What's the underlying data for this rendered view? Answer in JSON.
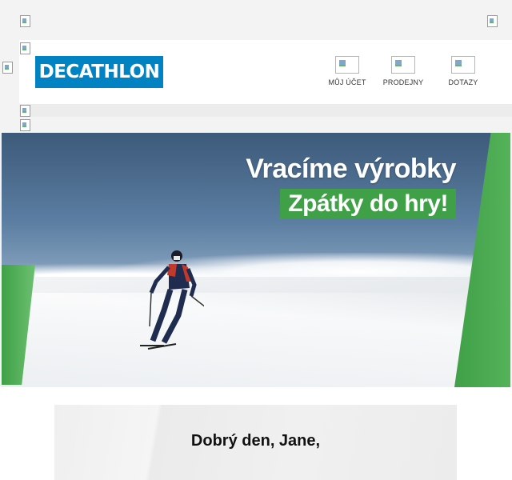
{
  "brand": {
    "logo_text": "DECATHLON",
    "color": "#0082c3"
  },
  "nav": [
    {
      "label": "MŮJ ÚČET",
      "icon": "account-icon"
    },
    {
      "label": "PRODEJNY",
      "icon": "store-icon"
    },
    {
      "label": "DOTAZY",
      "icon": "help-icon"
    }
  ],
  "hero": {
    "headline": "Vracíme výrobky",
    "subheadline": "Zpátky do hry!",
    "accent": "#3fa047"
  },
  "body": {
    "greeting": "Dobrý den, Jane,"
  }
}
